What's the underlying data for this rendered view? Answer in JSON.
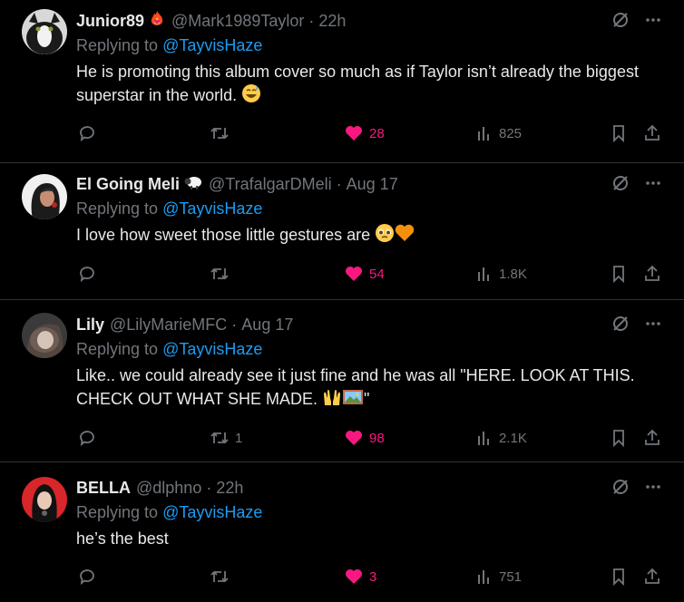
{
  "tweets": [
    {
      "name": "Junior89",
      "handle": "@Mark1989Taylor",
      "time": "22h",
      "replying_label": "Replying to ",
      "replying_to": "@TayvisHaze",
      "text": "He is promoting this album cover so much as if Taylor isn’t already the biggest superstar in the world.",
      "emoji_after": "grin-sweat-emoji",
      "badge": "fire-heart-icon",
      "replies": "",
      "retweets": "",
      "likes": "28",
      "views": "825",
      "liked": true
    },
    {
      "name": "El Going Meli",
      "handle": "@TrafalgarDMeli",
      "time": "Aug 17",
      "replying_label": "Replying to ",
      "replying_to": "@TayvisHaze",
      "text": "I love how sweet those little gestures are",
      "emoji_after": "pleading-face-orange-heart-emoji",
      "badge": "sheep-icon",
      "replies": "",
      "retweets": "",
      "likes": "54",
      "views": "1.8K",
      "liked": true
    },
    {
      "name": "Lily",
      "handle": "@LilyMarieMFC",
      "time": "Aug 17",
      "replying_label": "Replying to ",
      "replying_to": "@TayvisHaze",
      "text": "Like.. we could already see it just fine and he was all \"HERE. LOOK AT THIS. CHECK OUT WHAT SHE MADE.",
      "text_tail": "\"",
      "emoji_after": "raised-hands-picture-emoji",
      "badge": "",
      "replies": "",
      "retweets": "1",
      "likes": "98",
      "views": "2.1K",
      "liked": true
    },
    {
      "name": "BELLA",
      "handle": "@dlphno",
      "time": "22h",
      "replying_label": "Replying to ",
      "replying_to": "@TayvisHaze",
      "text": "he’s the best",
      "emoji_after": "",
      "badge": "",
      "replies": "",
      "retweets": "",
      "likes": "3",
      "views": "751",
      "liked": true
    }
  ],
  "separator": "·",
  "colors": {
    "background": "#000000",
    "text": "#e7e9ea",
    "muted": "#71767b",
    "link": "#1d9bf0",
    "like": "#f91880",
    "divider": "#2f3336"
  }
}
